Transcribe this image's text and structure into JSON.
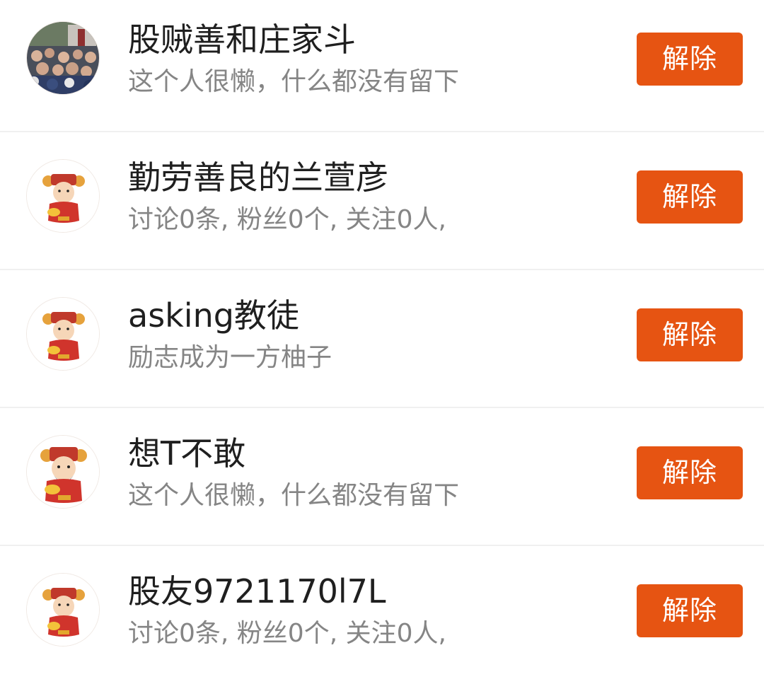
{
  "colors": {
    "accent": "#e65412",
    "name_text": "#1f1f1f",
    "desc_text": "#858585",
    "divider": "#f0f0f0"
  },
  "users": [
    {
      "name": "股贼善和庄家斗",
      "desc": "这个人很懒，什么都没有留下",
      "avatar": "crowd-photo-avatar",
      "action_label": "解除"
    },
    {
      "name": "勤劳善良的兰萱彦",
      "desc": "讨论0条, 粉丝0个, 关注0人,",
      "avatar": "fortune-god-avatar",
      "action_label": "解除"
    },
    {
      "name": "asking教徒",
      "desc": "励志成为一方柚子",
      "avatar": "fortune-god-avatar",
      "action_label": "解除"
    },
    {
      "name": "想T不敢",
      "desc": "这个人很懒，什么都没有留下",
      "avatar": "fortune-god-avatar",
      "action_label": "解除"
    },
    {
      "name": "股友9721170l7L",
      "desc": "讨论0条, 粉丝0个, 关注0人,",
      "avatar": "fortune-god-avatar",
      "action_label": "解除"
    }
  ]
}
